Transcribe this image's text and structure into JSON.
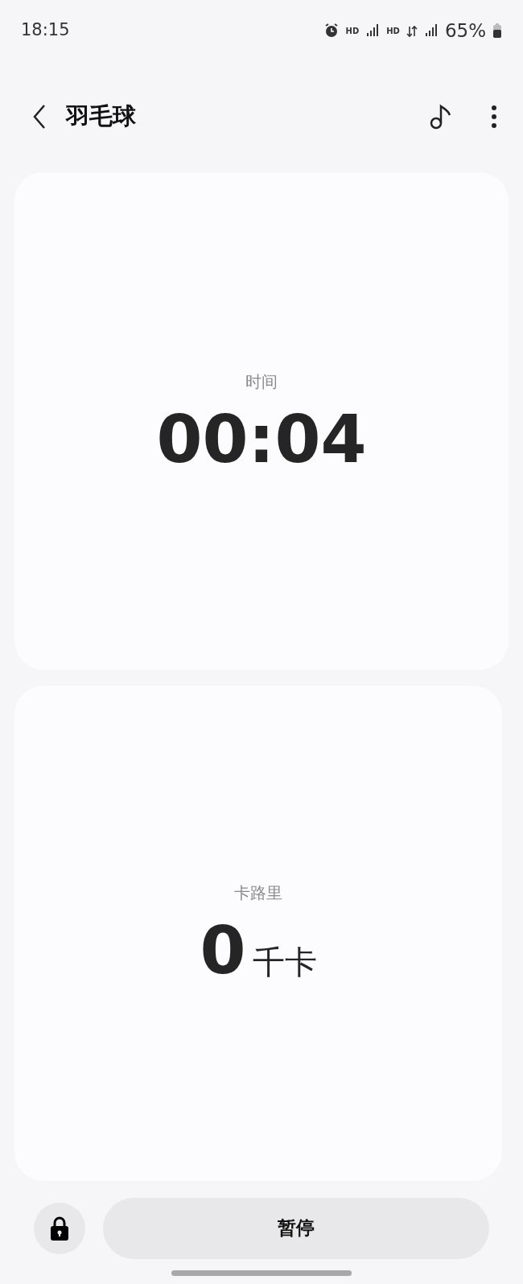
{
  "status_bar": {
    "time": "18:15",
    "network_labels": [
      "HD",
      "HD"
    ],
    "battery": "65%"
  },
  "header": {
    "title": "羽毛球"
  },
  "cards": [
    {
      "label": "时间",
      "value": "00:04"
    },
    {
      "label": "卡路里",
      "value": "0",
      "unit": "千卡"
    }
  ],
  "bottom": {
    "pause_button": "暂停"
  }
}
